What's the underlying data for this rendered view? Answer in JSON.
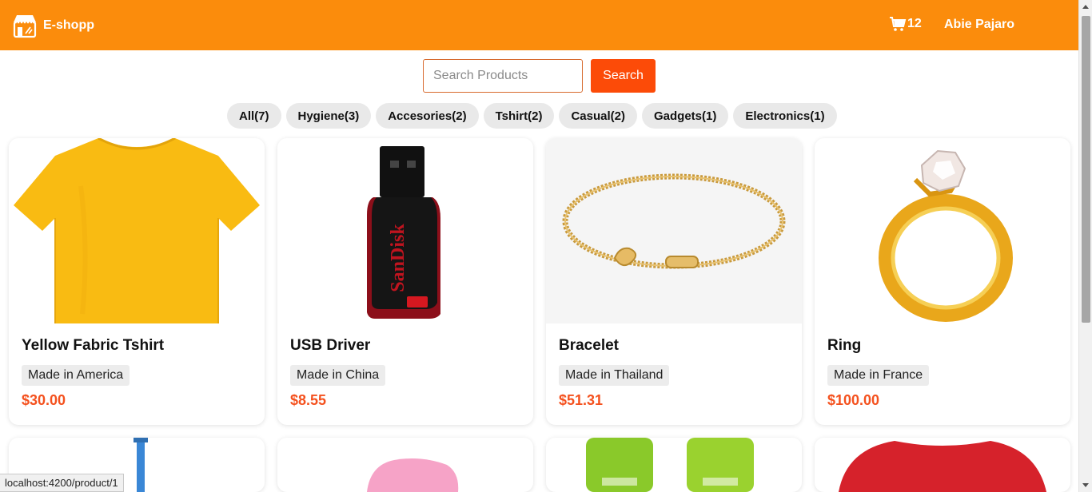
{
  "header": {
    "brand": "E-shopp",
    "cart_count": "12",
    "user_name": "Abie Pajaro",
    "colors": {
      "bar": "#fb8c0c",
      "accent": "#fc4b08"
    }
  },
  "search": {
    "placeholder": "Search Products",
    "value": "",
    "button_label": "Search"
  },
  "categories": [
    {
      "label": "All(7)"
    },
    {
      "label": "Hygiene(3)"
    },
    {
      "label": "Accesories(2)"
    },
    {
      "label": "Tshirt(2)"
    },
    {
      "label": "Casual(2)"
    },
    {
      "label": "Gadgets(1)"
    },
    {
      "label": "Electronics(1)"
    }
  ],
  "products": [
    {
      "title": "Yellow Fabric Tshirt",
      "origin": "Made in America",
      "price": "$30.00",
      "image": "yellow-tshirt"
    },
    {
      "title": "USB Driver",
      "origin": "Made in China",
      "price": "$8.55",
      "image": "usb-drive"
    },
    {
      "title": "Bracelet",
      "origin": "Made in Thailand",
      "price": "$51.31",
      "image": "gold-bracelet"
    },
    {
      "title": "Ring",
      "origin": "Made in France",
      "price": "$100.00",
      "image": "gold-ring"
    }
  ],
  "statusbar": {
    "url": "localhost:4200/product/1"
  }
}
